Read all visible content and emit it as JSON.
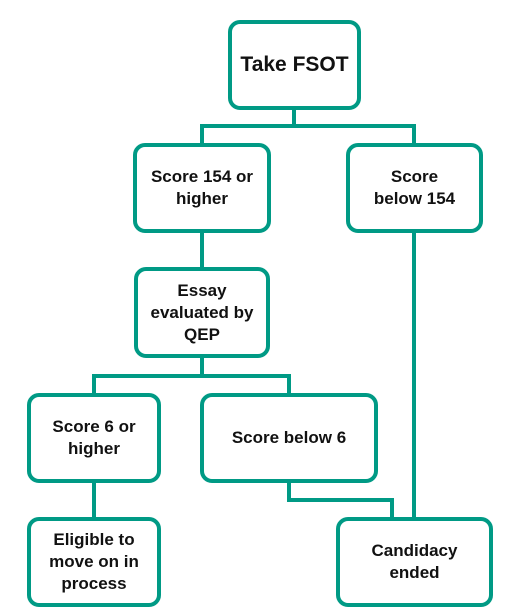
{
  "color": "#009a85",
  "nodes": {
    "take_fsot": "Take FSOT",
    "score_154_or_higher": "Score 154 or higher",
    "score_below_154": "Score below 154",
    "essay": "Essay evaluated by QEP",
    "score_6_or_higher": "Score 6 or higher",
    "score_below_6": "Score below 6",
    "eligible": "Eligible to move on in process",
    "candidacy_ended": "Candidacy ended"
  }
}
